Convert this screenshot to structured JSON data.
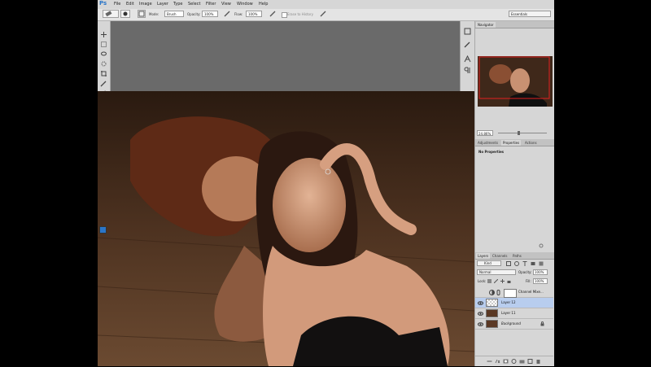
{
  "app": {
    "logo": "Ps"
  },
  "menubar": {
    "items": [
      "File",
      "Edit",
      "Image",
      "Layer",
      "Type",
      "Select",
      "Filter",
      "View",
      "Window",
      "Help"
    ]
  },
  "options": {
    "mode_label": "Mode:",
    "mode_value": "Brush",
    "opacity_label": "Opacity:",
    "opacity_value": "100%",
    "flow_label": "Flow:",
    "flow_value": "100%",
    "erase_history_label": "Erase to History",
    "workspace": "Essentials"
  },
  "toolbar": {
    "tools": [
      "move-tool",
      "marquee-tool",
      "lasso-tool",
      "quick-select-tool",
      "crop-tool",
      "eyedropper-tool",
      "healing-brush-tool",
      "brush-tool",
      "clone-stamp-tool",
      "history-brush-tool",
      "eraser-tool",
      "gradient-tool",
      "blur-tool",
      "dodge-tool",
      "pen-tool",
      "type-tool",
      "path-select-tool",
      "shape-tool",
      "hand-tool",
      "zoom-tool"
    ]
  },
  "navigator": {
    "title": "Navigator",
    "zoom": "24.86%"
  },
  "properties": {
    "tabs": [
      "Adjustments",
      "Properties",
      "Actions"
    ],
    "content": "No Properties"
  },
  "layers": {
    "tabs": [
      "Layers",
      "Channels",
      "Paths"
    ],
    "filter": "Kind",
    "blend_mode": "Normal",
    "opacity_label": "Opacity:",
    "opacity_value": "100%",
    "lock_label": "Lock:",
    "fill_label": "Fill:",
    "fill_value": "100%",
    "items": [
      {
        "name": "Channel Mixe..."
      },
      {
        "name": "Layer 12"
      },
      {
        "name": "Layer 11"
      },
      {
        "name": "Background"
      }
    ]
  },
  "colors": {
    "accent": "#2b76c8",
    "selected_layer": "#b8cdee",
    "nav_frame": "#e02020"
  }
}
